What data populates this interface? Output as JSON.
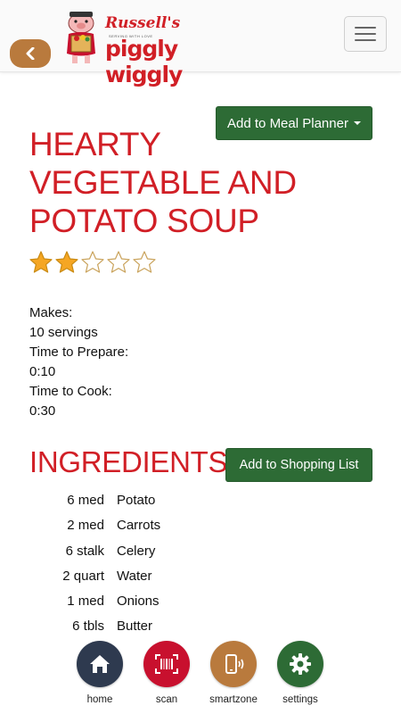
{
  "header": {
    "logo_script": "Russell's",
    "logo_tagline": "SERVING WITH LOVE",
    "logo_main": "piggly wiggly"
  },
  "recipe": {
    "meal_planner_label": "Add to Meal Planner",
    "title": "HEARTY VEGETABLE AND POTATO SOUP",
    "rating": 2,
    "rating_max": 5,
    "makes_label": "Makes:",
    "makes_value": "10 servings",
    "prep_label": "Time to Prepare:",
    "prep_value": "0:10",
    "cook_label": "Time to Cook:",
    "cook_value": "0:30"
  },
  "ingredients": {
    "heading": "INGREDIENTS",
    "shopping_label": "Add to Shopping List",
    "items": [
      {
        "qty": "6 med",
        "name": "Potato"
      },
      {
        "qty": "2 med",
        "name": "Carrots"
      },
      {
        "qty": "6 stalk",
        "name": "Celery"
      },
      {
        "qty": "2 quart",
        "name": "Water"
      },
      {
        "qty": "1 med",
        "name": "Onions"
      },
      {
        "qty": "6 tbls",
        "name": "Butter"
      }
    ]
  },
  "nav": {
    "items": [
      {
        "label": "home",
        "icon": "home-icon",
        "color": "#2e3a4f"
      },
      {
        "label": "scan",
        "icon": "barcode-icon",
        "color": "#c8102e"
      },
      {
        "label": "smartzone",
        "icon": "smartphone-signal-icon",
        "color": "#b97a3d"
      },
      {
        "label": "settings",
        "icon": "gear-icon",
        "color": "#2d6b35"
      }
    ]
  },
  "colors": {
    "brand_red": "#d11f26",
    "button_green": "#2d6b35",
    "back_brown": "#b97a3d",
    "star_gold": "#f5a623"
  }
}
